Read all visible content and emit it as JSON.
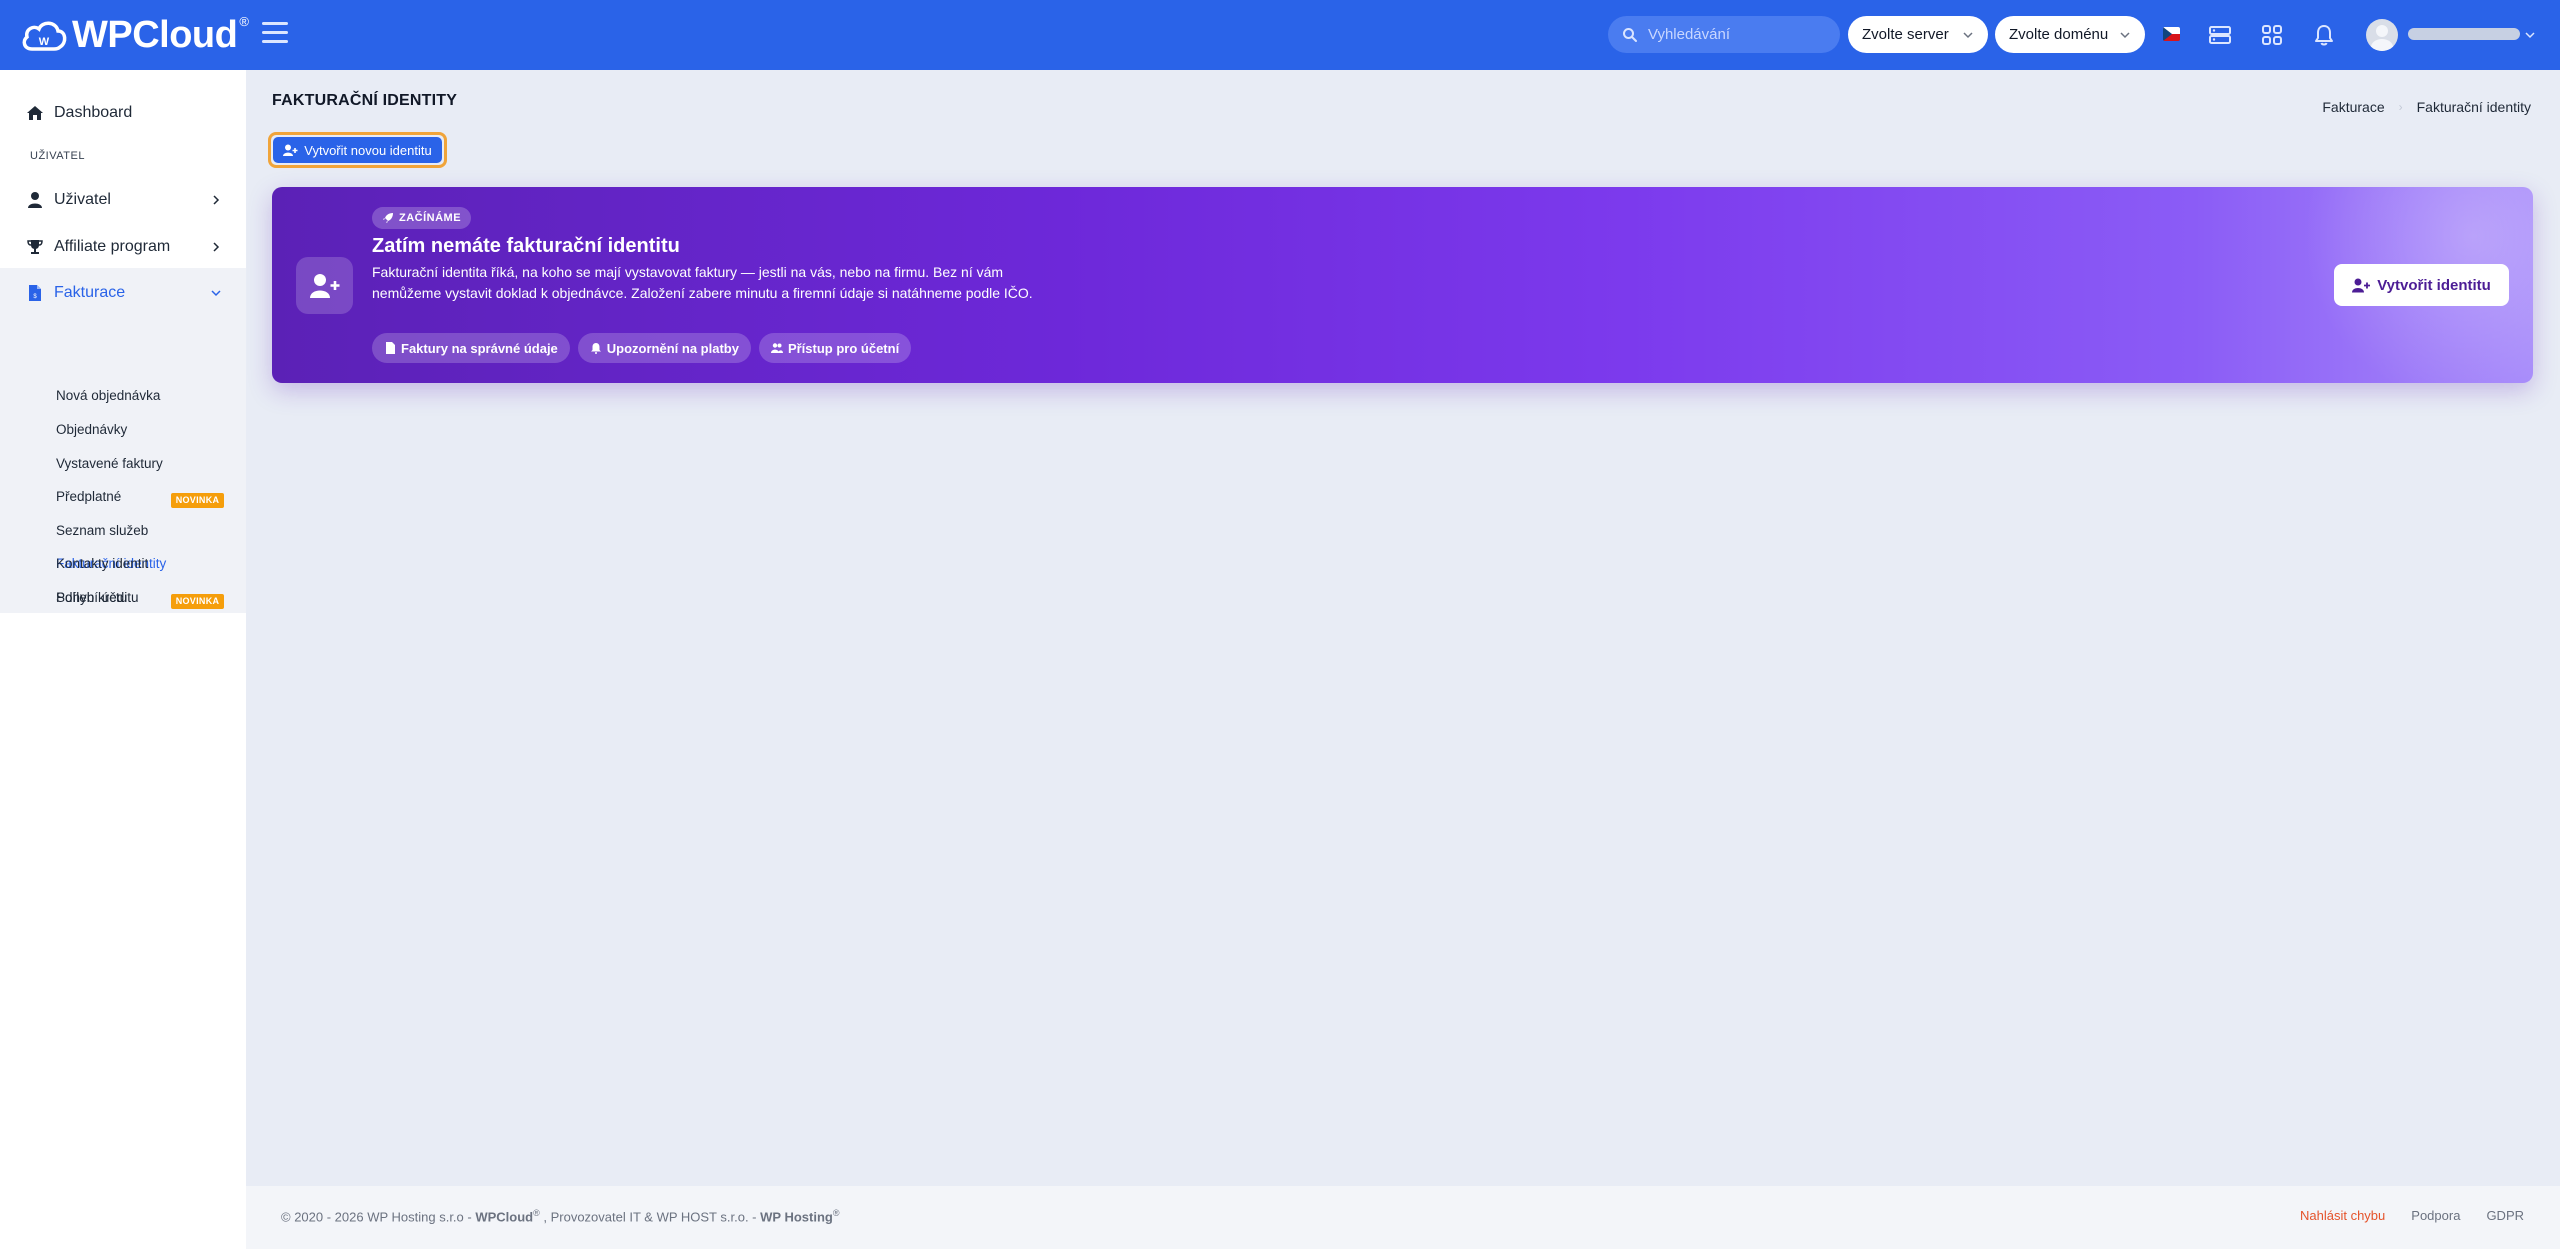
{
  "header": {
    "logo_text": "WPCloud",
    "logo_reg": "®",
    "search_placeholder": "Vyhledávání",
    "server_select": "Zvolte server",
    "domain_select": "Zvolte doménu",
    "language_flag": "cz-flag",
    "icons": [
      "menu-icon",
      "search-icon",
      "server-icon",
      "apps-icon",
      "bell-icon"
    ]
  },
  "sidebar": {
    "dashboard": "Dashboard",
    "section_label": "UŽIVATEL",
    "user": "Uživatel",
    "affiliate": "Affiliate program",
    "billing": "Fakturace",
    "submenu": [
      {
        "label": "Nová objednávka"
      },
      {
        "label": "Objednávky"
      },
      {
        "label": "Vystavené faktury"
      },
      {
        "label": "Předplatné",
        "badge": "NOVINKA"
      },
      {
        "label": "Seznam služeb"
      },
      {
        "label": "Fakturační identity",
        "active": true
      },
      {
        "label": "Sdílení účtu",
        "badge": "NOVINKA"
      },
      {
        "label": "Kontakty identit"
      },
      {
        "label": "Pohyb kreditu"
      }
    ]
  },
  "page": {
    "title": "FAKTURAČNÍ IDENTITY",
    "breadcrumb": [
      "Fakturace",
      "Fakturační identity"
    ],
    "create_button": "Vytvořit novou identitu"
  },
  "banner": {
    "tag": "ZAČÍNÁME",
    "title": "Zatím nemáte fakturační identitu",
    "text": "Fakturační identita říká, na koho se mají vystavovat faktury — jestli na vás, nebo na firmu. Bez ní vám nemůžeme vystavit doklad k objednávce. Založení zabere minutu a firemní údaje si natáhneme podle IČO.",
    "chips": [
      "Faktury na správné údaje",
      "Upozornění na platby",
      "Přístup pro účetní"
    ],
    "button": "Vytvořit identitu"
  },
  "footer": {
    "copyright": "© 2020 - 2026 WP Hosting s.r.o -",
    "brand1": "WPCloud",
    "middle": ", Provozovatel IT & WP HOST s.r.o. -",
    "brand2": "WP Hosting",
    "reg": "®",
    "links": [
      "Nahlásit chybu",
      "Podpora",
      "GDPR"
    ]
  },
  "colors": {
    "primary": "#2a63e8",
    "banner_start": "#5b21b6",
    "banner_end": "#a78bfa",
    "badge": "#f59e0b",
    "focus_ring": "#f0a43a",
    "error_link": "#e5532b"
  }
}
